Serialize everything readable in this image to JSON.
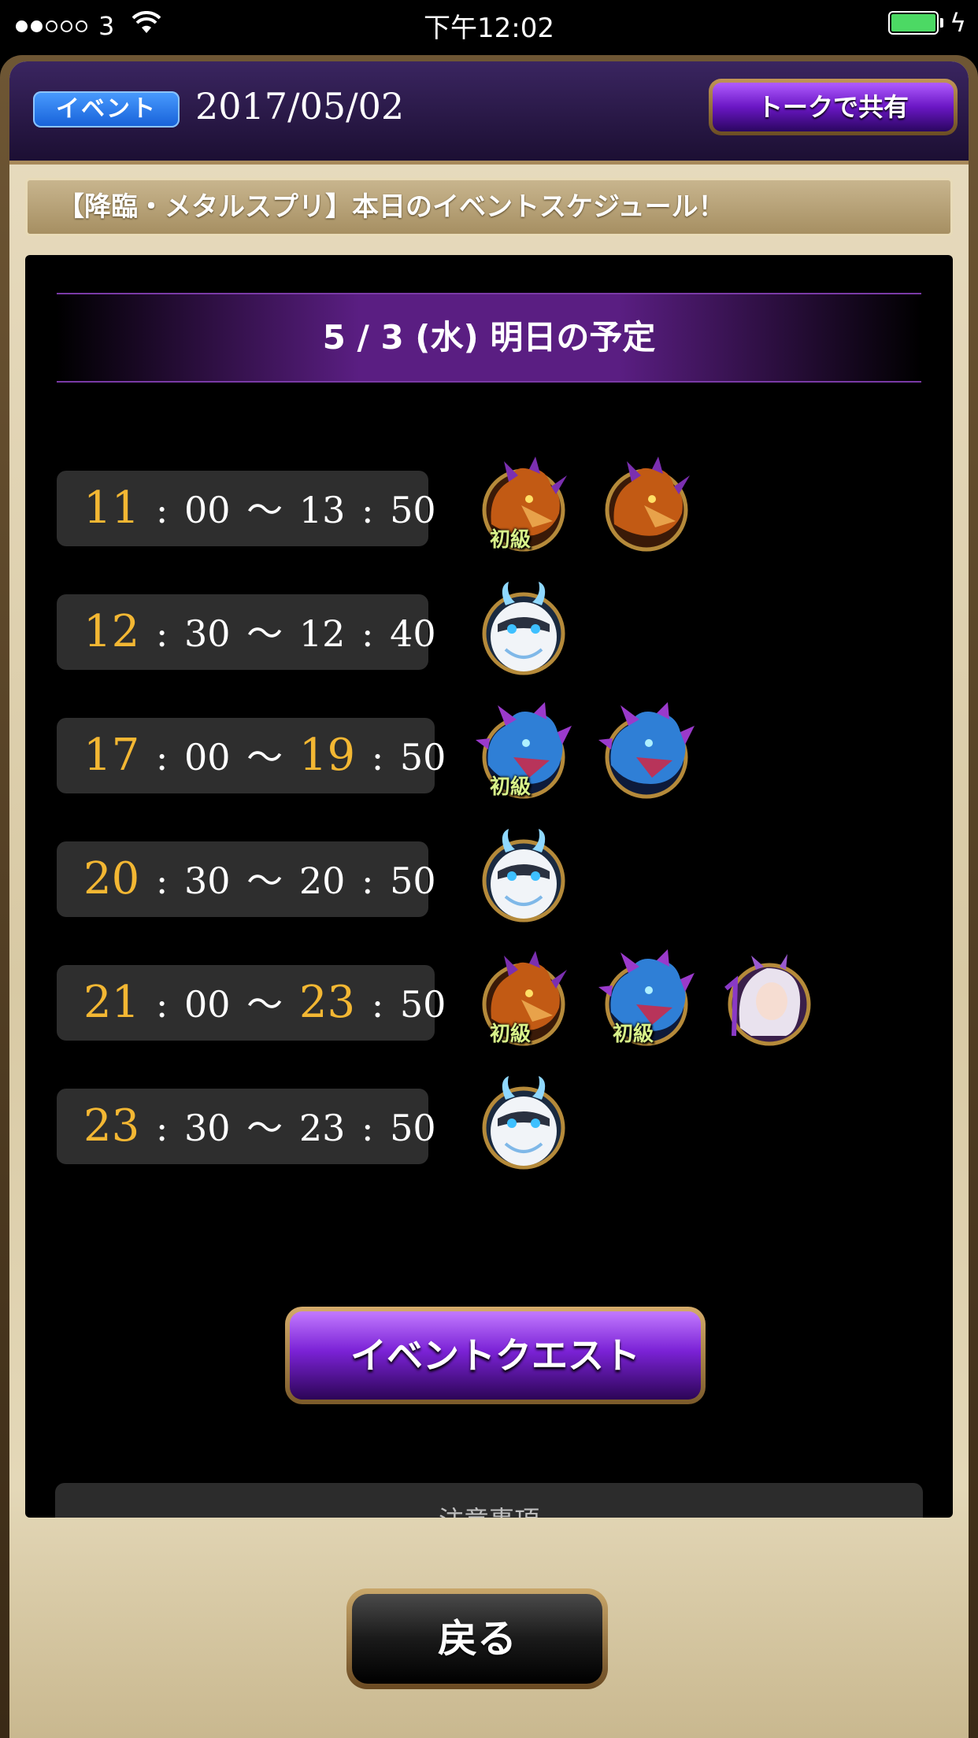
{
  "status_bar": {
    "carrier": "3",
    "time": "下午12:02"
  },
  "header": {
    "badge": "イベント",
    "date": "2017/05/02",
    "share_label": "トークで共有"
  },
  "notice": "【降臨・メタルスプリ】本日のイベントスケジュール！",
  "schedule": {
    "title": "5 / 3 (水) 明日の予定",
    "rows": [
      {
        "start_h": "11",
        "start_m": "00",
        "end_h": "13",
        "end_m": "50",
        "start_hl": true,
        "end_hl": false,
        "icons": [
          "red-dragon-icon",
          "red-dragon-icon"
        ],
        "tags": [
          "初級",
          ""
        ]
      },
      {
        "start_h": "12",
        "start_m": "30",
        "end_h": "12",
        "end_m": "40",
        "start_hl": true,
        "end_hl": false,
        "icons": [
          "white-owl-icon"
        ],
        "tags": [
          ""
        ]
      },
      {
        "start_h": "17",
        "start_m": "00",
        "end_h": "19",
        "end_m": "50",
        "start_hl": true,
        "end_hl": true,
        "icons": [
          "blue-dragon-icon",
          "blue-dragon-icon"
        ],
        "tags": [
          "初級",
          ""
        ]
      },
      {
        "start_h": "20",
        "start_m": "30",
        "end_h": "20",
        "end_m": "50",
        "start_hl": true,
        "end_hl": false,
        "icons": [
          "white-owl-icon"
        ],
        "tags": [
          ""
        ]
      },
      {
        "start_h": "21",
        "start_m": "00",
        "end_h": "23",
        "end_m": "50",
        "start_hl": true,
        "end_hl": true,
        "icons": [
          "red-dragon-icon",
          "blue-dragon-icon",
          "silver-haired-character-icon"
        ],
        "tags": [
          "初級",
          "初級",
          ""
        ]
      },
      {
        "start_h": "23",
        "start_m": "30",
        "end_h": "23",
        "end_m": "50",
        "start_hl": true,
        "end_hl": false,
        "icons": [
          "white-owl-icon"
        ],
        "tags": [
          ""
        ]
      }
    ]
  },
  "event_quest_label": "イベントクエスト",
  "notes_label": "注意事項",
  "back_label": "戻る",
  "colors": {
    "highlight": "#f3b733",
    "purple": "#7b22d6",
    "badge_blue": "#1660d8",
    "battery_green": "#4cd964"
  }
}
